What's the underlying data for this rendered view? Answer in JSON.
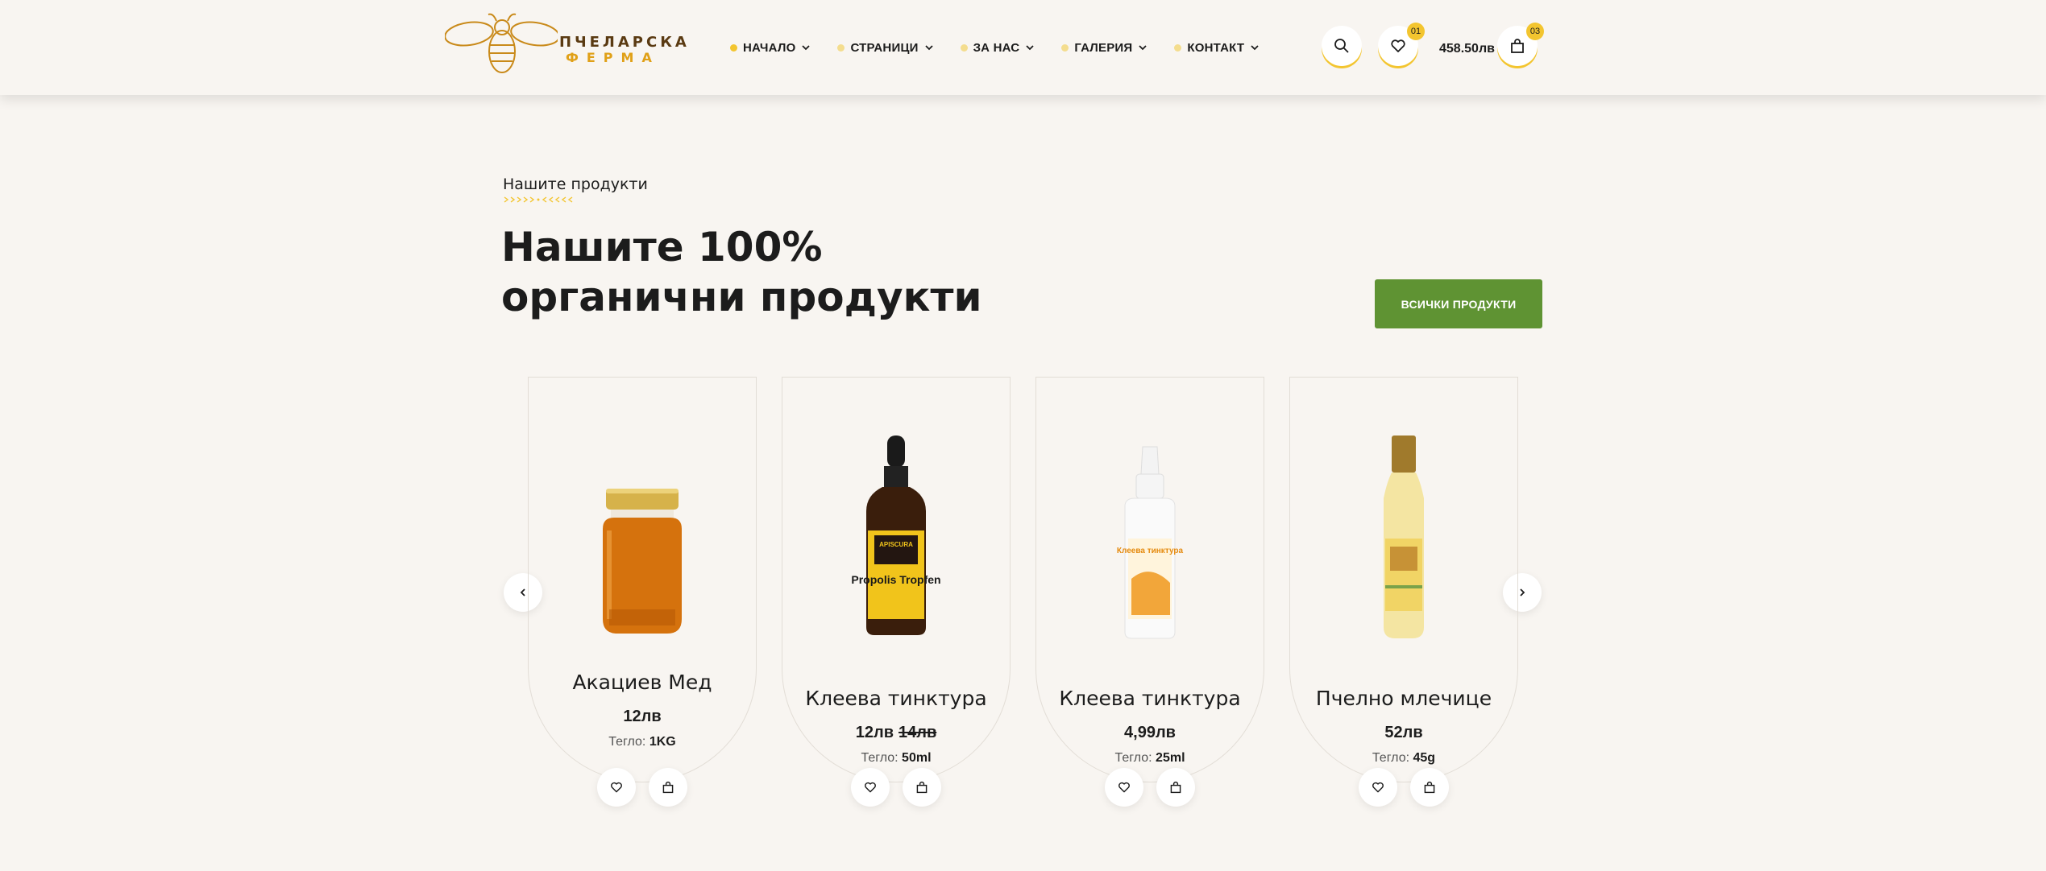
{
  "header": {
    "logo": {
      "line1": "ПЧЕЛАРСКА",
      "line2": "ФЕРМА"
    },
    "nav": [
      {
        "label": "НАЧАЛО"
      },
      {
        "label": "СТРАНИЦИ"
      },
      {
        "label": "ЗА НАС"
      },
      {
        "label": "ГАЛЕРИЯ"
      },
      {
        "label": "КОНТАКТ"
      }
    ],
    "wishlist_count": "01",
    "cart_total": "458.50лв",
    "cart_count": "03"
  },
  "section": {
    "eyebrow": "Нашите продукти",
    "title_line1": "Нашите 100%",
    "title_line2": "органични продукти",
    "all_button": "ВСИЧКИ ПРОДУКТИ"
  },
  "products": [
    {
      "title": "Акациев Мед",
      "price": "12лв",
      "old_price": "",
      "weight_label": "Тегло:",
      "weight": "1KG"
    },
    {
      "title": "Клеева тинктура",
      "price": "12лв",
      "old_price": "14лв",
      "weight_label": "Тегло:",
      "weight": "50ml",
      "label_text": "Propolis Tropfen",
      "brand": "APISCURA"
    },
    {
      "title": "Клеева тинктура",
      "price": "4,99лв",
      "old_price": "",
      "weight_label": "Тегло:",
      "weight": "25ml",
      "label_text": "Клеева тинктура"
    },
    {
      "title": "Пчелно млечице",
      "price": "52лв",
      "old_price": "",
      "weight_label": "Тегло:",
      "weight": "45g"
    }
  ],
  "colors": {
    "accent": "#f3c52f",
    "button": "#5f9333",
    "background": "#f8f5f1"
  }
}
